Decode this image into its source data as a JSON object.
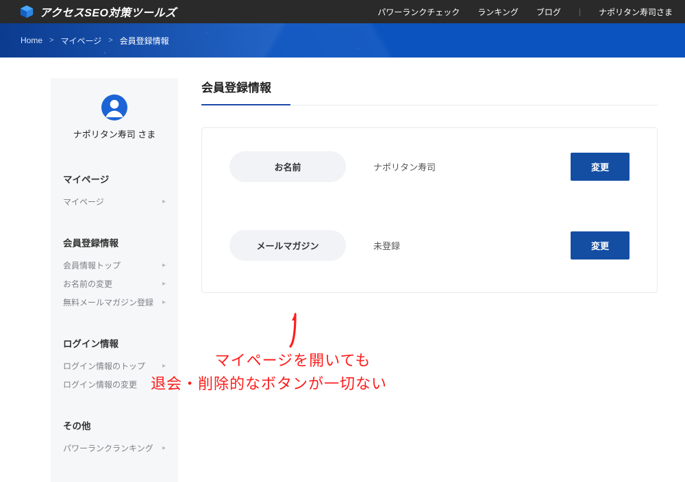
{
  "brand": "アクセスSEO対策ツールズ",
  "topnav": {
    "power_rank_check": "パワーランクチェック",
    "ranking": "ランキング",
    "blog": "ブログ",
    "user_greeting": "ナポリタン寿司さま"
  },
  "breadcrumb": {
    "home": "Home",
    "mypage": "マイページ",
    "current": "会員登録情報"
  },
  "sidebar": {
    "username": "ナポリタン寿司 さま",
    "sections": {
      "mypage": {
        "heading": "マイページ",
        "items": [
          "マイページ"
        ]
      },
      "member": {
        "heading": "会員登録情報",
        "items": [
          "会員情報トップ",
          "お名前の変更",
          "無料メールマガジン登録"
        ]
      },
      "login": {
        "heading": "ログイン情報",
        "items": [
          "ログイン情報のトップ",
          "ログイン情報の変更"
        ]
      },
      "other": {
        "heading": "その他",
        "items": [
          "パワーランクランキング"
        ]
      }
    }
  },
  "main": {
    "title": "会員登録情報",
    "rows": {
      "name": {
        "label": "お名前",
        "value": "ナポリタン寿司",
        "button": "変更"
      },
      "magazine": {
        "label": "メールマガジン",
        "value": "未登録",
        "button": "変更"
      }
    }
  },
  "annotation": {
    "line1": "マイページを開いても",
    "line2": "退会・削除的なボタンが一切ない"
  }
}
